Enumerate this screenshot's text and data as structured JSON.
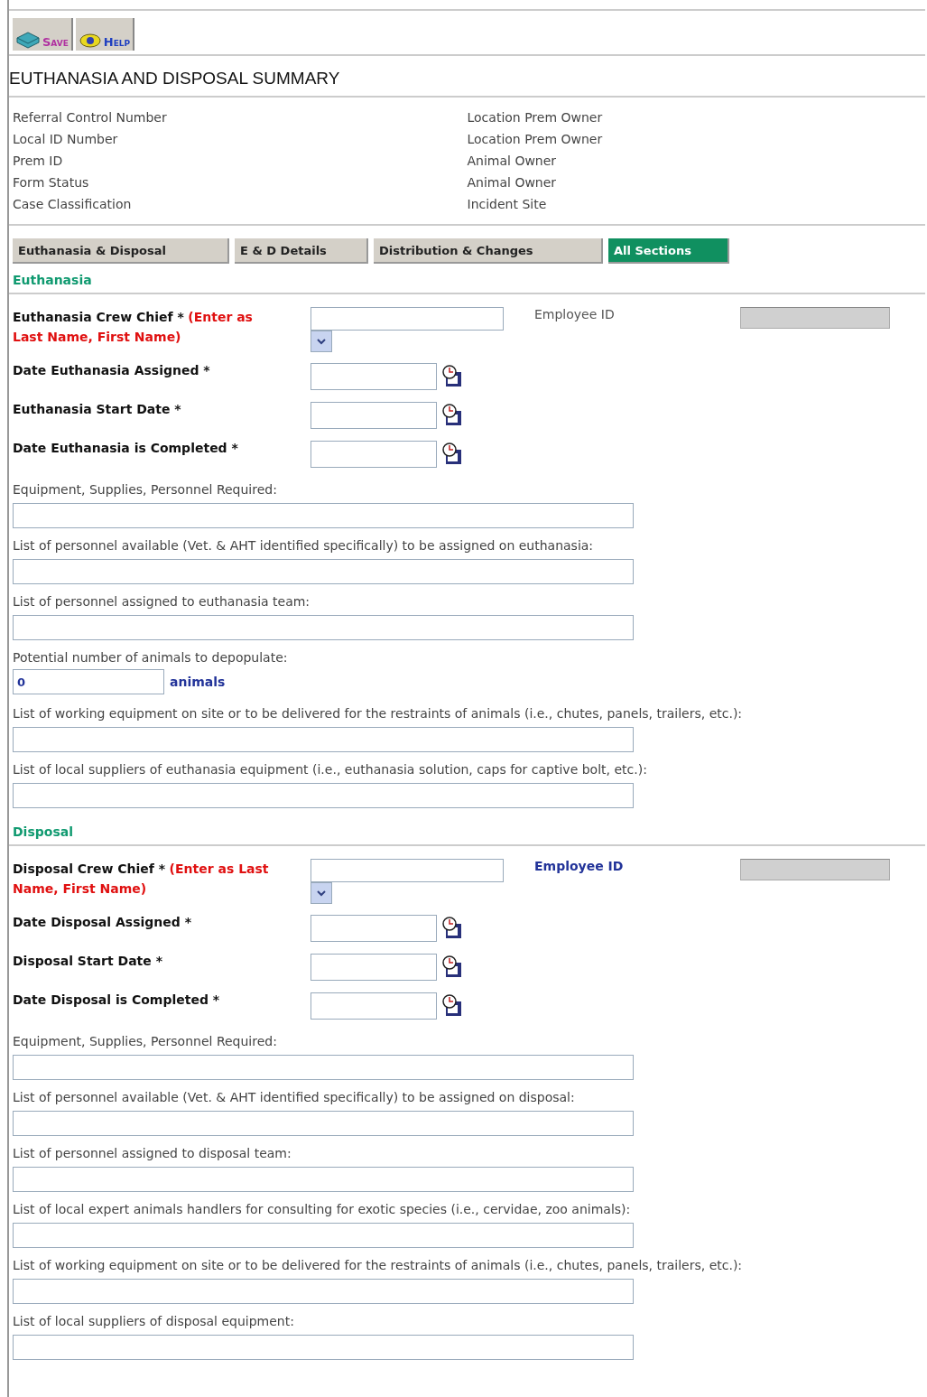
{
  "toolbar": [
    {
      "label": "Save",
      "kind": "save"
    },
    {
      "label": "Help",
      "kind": "help"
    }
  ],
  "title": "EUTHANASIA AND DISPOSAL SUMMARY",
  "summary": {
    "left": [
      "Referral Control Number",
      "Local ID Number",
      "Prem ID",
      "Form Status",
      "Case Classification"
    ],
    "right": [
      "Location Prem Owner",
      "Location Prem Owner",
      "Animal Owner",
      "Animal Owner",
      "Incident Site"
    ]
  },
  "tabs": [
    {
      "label": "Euthanasia & Disposal",
      "selected": false
    },
    {
      "label": "E & D Details",
      "selected": false
    },
    {
      "label": "Distribution & Changes",
      "selected": false
    },
    {
      "label": "All Sections",
      "selected": true
    }
  ],
  "sections": [
    {
      "heading": "Euthanasia",
      "crew_chief": {
        "label": "Euthanasia Crew Chief *",
        "note": "(Enter as Last Name, First Name)",
        "employee_id": "Employee ID",
        "employee_id_emphasis": false
      },
      "dates": [
        "Date Euthanasia Assigned *",
        "Euthanasia Start Date *",
        "Date Euthanasia is Completed *"
      ],
      "fields": [
        {
          "kind": "text",
          "label": "Equipment, Supplies, Personnel Required:"
        },
        {
          "kind": "text",
          "label": "List of personnel available (Vet. & AHT identified specifically) to be assigned on euthanasia:"
        },
        {
          "kind": "text",
          "label": "List of personnel assigned to euthanasia team:"
        },
        {
          "kind": "number",
          "label": "Potential number of animals to depopulate:",
          "value": "0",
          "unit": "animals"
        },
        {
          "kind": "text",
          "label": "List of working equipment on site or to be delivered for the restraints of animals (i.e., chutes, panels, trailers, etc.):"
        },
        {
          "kind": "text",
          "label": "List of local suppliers of euthanasia equipment (i.e., euthanasia solution, caps for captive bolt, etc.):"
        }
      ]
    },
    {
      "heading": "Disposal",
      "crew_chief": {
        "label": "Disposal Crew Chief *",
        "note": "(Enter as Last Name, First Name)",
        "employee_id": "Employee ID",
        "employee_id_emphasis": true
      },
      "dates": [
        "Date Disposal Assigned *",
        "Disposal Start Date *",
        "Date Disposal is Completed *"
      ],
      "fields": [
        {
          "kind": "text",
          "label": "Equipment, Supplies, Personnel Required:"
        },
        {
          "kind": "text",
          "label": "List of personnel available (Vet. & AHT identified specifically) to be assigned on disposal:"
        },
        {
          "kind": "text",
          "label": "List of personnel assigned to disposal team:"
        },
        {
          "kind": "text",
          "label": "List of local expert animals handlers for consulting for exotic species (i.e., cervidae, zoo animals):"
        },
        {
          "kind": "text",
          "label": "List of working equipment on site or to be delivered for the restraints of animals (i.e., chutes, panels, trailers, etc.):"
        },
        {
          "kind": "text",
          "label": "List of local suppliers of disposal equipment:"
        }
      ]
    }
  ]
}
